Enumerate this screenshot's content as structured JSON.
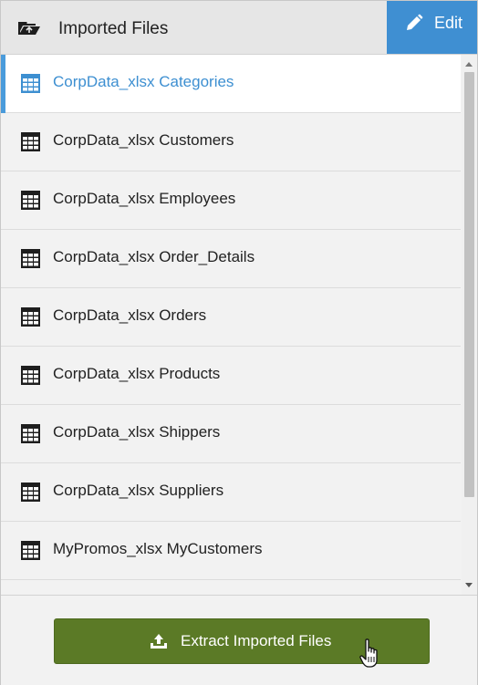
{
  "header": {
    "title": "Imported Files",
    "icon": "open-folder-icon",
    "edit_label": "Edit",
    "edit_icon": "pencil-icon",
    "accent_color": "#3f8fd2"
  },
  "files": {
    "items": [
      {
        "label": "CorpData_xlsx Categories",
        "icon": "table-icon",
        "selected": true
      },
      {
        "label": "CorpData_xlsx Customers",
        "icon": "table-icon",
        "selected": false
      },
      {
        "label": "CorpData_xlsx Employees",
        "icon": "table-icon",
        "selected": false
      },
      {
        "label": "CorpData_xlsx Order_Details",
        "icon": "table-icon",
        "selected": false
      },
      {
        "label": "CorpData_xlsx Orders",
        "icon": "table-icon",
        "selected": false
      },
      {
        "label": "CorpData_xlsx Products",
        "icon": "table-icon",
        "selected": false
      },
      {
        "label": "CorpData_xlsx Shippers",
        "icon": "table-icon",
        "selected": false
      },
      {
        "label": "CorpData_xlsx Suppliers",
        "icon": "table-icon",
        "selected": false
      },
      {
        "label": "MyPromos_xlsx MyCustomers",
        "icon": "table-icon",
        "selected": false
      }
    ],
    "selected_color": "#3d8fd1"
  },
  "footer": {
    "extract_label": "Extract Imported Files",
    "extract_icon": "upload-icon",
    "button_color": "#5b7a26"
  }
}
